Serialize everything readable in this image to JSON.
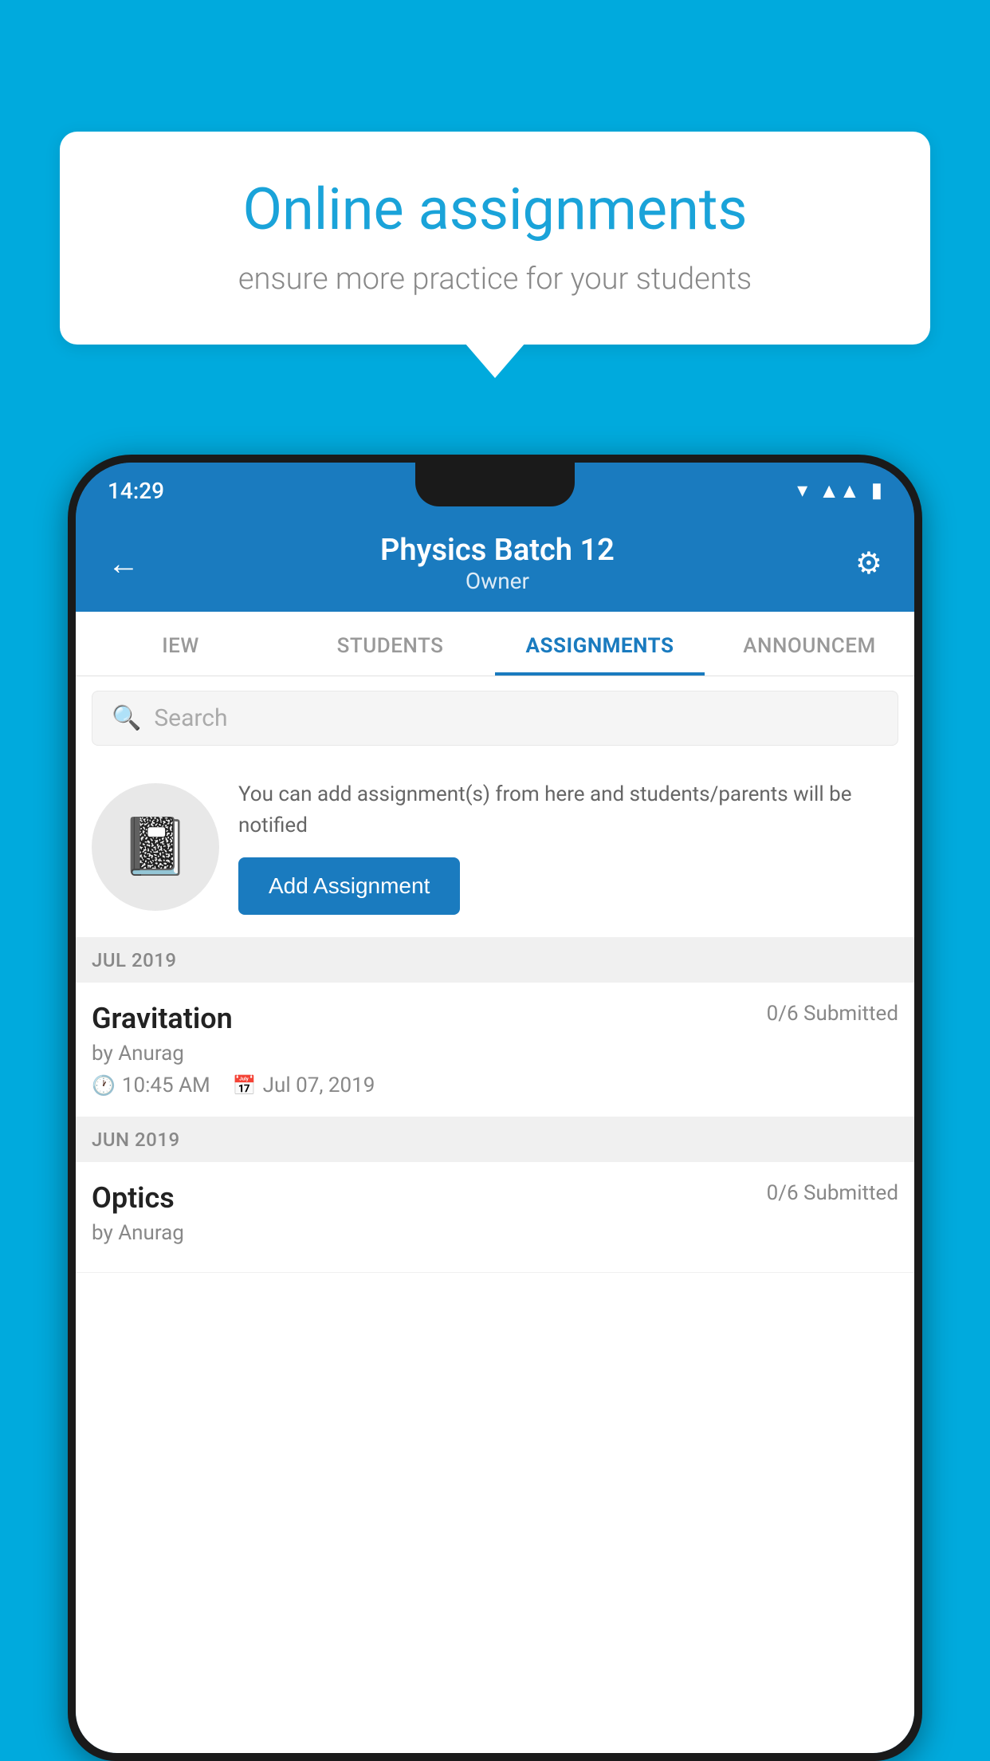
{
  "background_color": "#00AADD",
  "speech_bubble": {
    "title": "Online assignments",
    "subtitle": "ensure more practice for your students"
  },
  "phone": {
    "status_bar": {
      "time": "14:29"
    },
    "header": {
      "title": "Physics Batch 12",
      "subtitle": "Owner",
      "back_label": "←",
      "settings_label": "⚙"
    },
    "tabs": [
      {
        "label": "IEW",
        "active": false
      },
      {
        "label": "STUDENTS",
        "active": false
      },
      {
        "label": "ASSIGNMENTS",
        "active": true
      },
      {
        "label": "ANNOUNCEM",
        "active": false
      }
    ],
    "search": {
      "placeholder": "Search"
    },
    "promo": {
      "text": "You can add assignment(s) from here and students/parents will be notified",
      "button_label": "Add Assignment"
    },
    "sections": [
      {
        "label": "JUL 2019",
        "assignments": [
          {
            "name": "Gravitation",
            "submitted": "0/6 Submitted",
            "by": "by Anurag",
            "time": "10:45 AM",
            "date": "Jul 07, 2019"
          }
        ]
      },
      {
        "label": "JUN 2019",
        "assignments": [
          {
            "name": "Optics",
            "submitted": "0/6 Submitted",
            "by": "by Anurag",
            "time": "",
            "date": ""
          }
        ]
      }
    ]
  }
}
